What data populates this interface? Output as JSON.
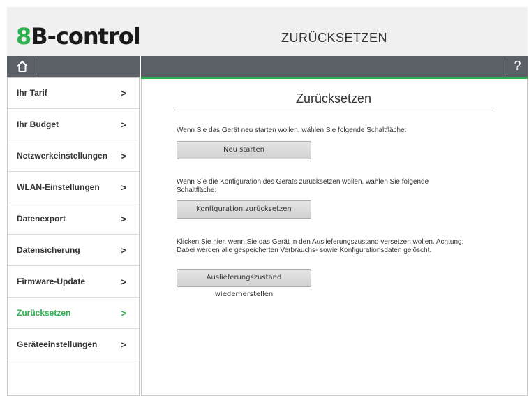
{
  "header": {
    "logo_prefix": "8",
    "logo_rest": "B-control",
    "page_heading": "ZURÜCKSETZEN"
  },
  "toolbar": {
    "home_icon": "home-icon",
    "help_label": "?"
  },
  "colors": {
    "accent": "#2bb24c",
    "bar": "#5a6066"
  },
  "sidebar": {
    "items": [
      {
        "label": "Ihr Tarif",
        "chevron": ">"
      },
      {
        "label": "Ihr Budget",
        "chevron": ">"
      },
      {
        "label": "Netzwerkeinstellungen",
        "chevron": ">"
      },
      {
        "label": "WLAN-Einstellungen",
        "chevron": ">"
      },
      {
        "label": "Datenexport",
        "chevron": ">"
      },
      {
        "label": "Datensicherung",
        "chevron": ">"
      },
      {
        "label": "Firmware-Update",
        "chevron": ">"
      },
      {
        "label": "Zurücksetzen",
        "chevron": ">",
        "active": true
      },
      {
        "label": "Geräteeinstellungen",
        "chevron": ">"
      }
    ]
  },
  "main": {
    "title": "Zurücksetzen",
    "sections": [
      {
        "text": "Wenn Sie das Gerät neu starten wollen, wählen Sie folgende Schaltfläche:",
        "button": "Neu starten"
      },
      {
        "text": "Wenn Sie die Konfiguration des Geräts zurücksetzen wollen, wählen Sie folgende Schaltfläche:",
        "button": "Konfiguration zurücksetzen"
      },
      {
        "text": "Klicken Sie hier, wenn Sie das Gerät in den Auslieferungszustand versetzen wollen. Achtung: Dabei werden alle gespeicherten Verbrauchs- sowie Konfigurationsdaten gelöscht.",
        "button": "Auslieferungszustand wiederherstellen"
      }
    ]
  }
}
